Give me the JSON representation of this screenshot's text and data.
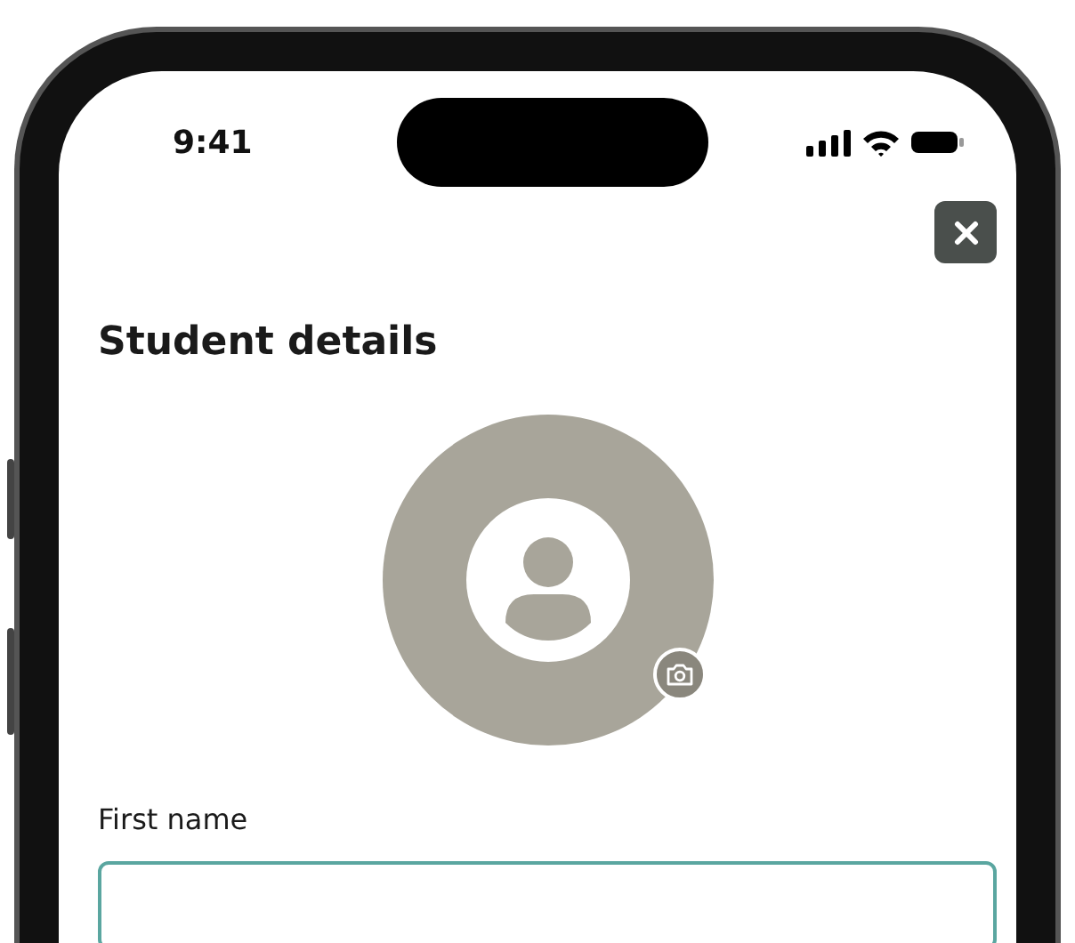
{
  "status_bar": {
    "time": "9:41"
  },
  "header": {
    "title": "Student details"
  },
  "avatar": {
    "has_photo": false
  },
  "form": {
    "fields": [
      {
        "label": "First name",
        "focused": true
      }
    ]
  }
}
